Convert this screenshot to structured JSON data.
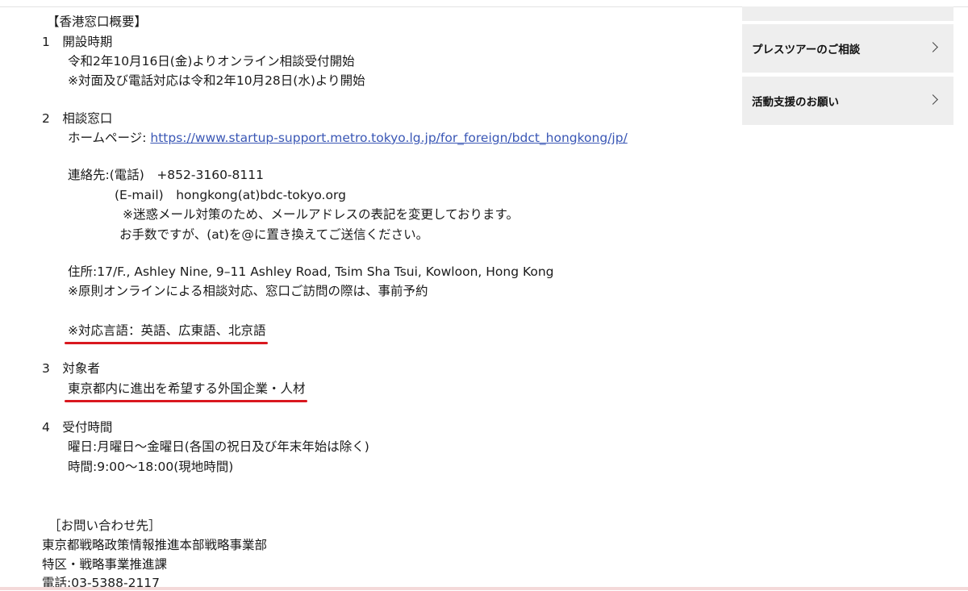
{
  "content": {
    "heading": "【香港窓口概要】",
    "s1_title": "1　開設時期",
    "s1_l1": "令和2年10月16日(金)よりオンライン相談受付開始",
    "s1_l2": "※対面及び電話対応は令和2年10月28日(水)より開始",
    "s2_title": "2　相談窓口",
    "homepage_label": "ホームページ: ",
    "homepage_url": "https://www.startup-support.metro.tokyo.lg.jp/for_foreign/bdct_hongkong/jp/",
    "contact_phone_line": "連絡先:(電話)　+852-3160-8111",
    "contact_email_line": "(E-mail)　hongkong(at)bdc-tokyo.org",
    "email_note_1": "※迷惑メール対策のため、メールアドレスの表記を変更しております。",
    "email_note_2": "お手数ですが、(at)を@に置き換えてご送信ください。",
    "address": "住所:17/F., Ashley Nine, 9–11 Ashley Road, Tsim Sha Tsui, Kowloon, Hong Kong",
    "address_note": "※原則オンラインによる相談対応、窓口ご訪問の際は、事前予約",
    "languages": "※対応言語：英語、広東語、北京語",
    "s3_title": "3　対象者",
    "s3_l1": "東京都内に進出を希望する外国企業・人材",
    "s4_title": "4　受付時間",
    "s4_l1": "曜日:月曜日～金曜日(各国の祝日及び年末年始は除く)",
    "s4_l2": "時間:9:00～18:00(現地時間)",
    "inquiry_heading": "［お問い合わせ先］",
    "inquiry_l1": "東京都戦略政策情報推進本部戦略事業部",
    "inquiry_l2": "特区・戦略事業推進課",
    "inquiry_l3": "電話:03-5388-2117"
  },
  "sidebar": {
    "items": [
      {
        "label": "プレスツアーのご相談",
        "icon": "chevron-right-icon"
      },
      {
        "label": "活動支援のお願い",
        "icon": "chevron-right-icon"
      }
    ]
  },
  "colors": {
    "link": "#3a57b5",
    "highlight_underline": "#d9181f",
    "sidebar_bg": "#eeeeee"
  }
}
